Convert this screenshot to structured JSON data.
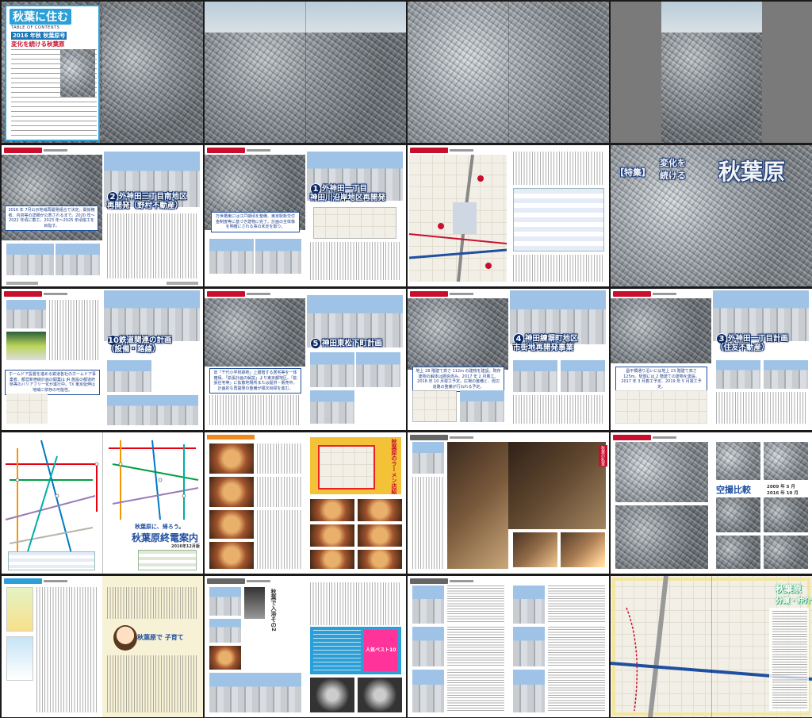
{
  "toc": {
    "title": "秋葉に住む",
    "subtitle": "TABLE OF CONTENTS",
    "issue": "2016 年秋 秋葉原号",
    "feature": "変化を続ける秋葉原"
  },
  "spreads": {
    "s2_2": {
      "headline_num": "2",
      "headline_l1": "外神田三丁目南地区",
      "headline_l2": "再開発（野村不動産）",
      "caption": "2016 年 7月公示地域再開発組合で決定。関係権者、内容等の詳細が公表されるまで。2020 年〜2022 年頃に着工。2023 年〜2025 年頃竣工を目指す。"
    },
    "s2_3": {
      "headline_num": "1",
      "headline_l1": "外神田一丁目",
      "headline_l2": "神田川沿岸地区再開発",
      "caption": "万世橋東には江戸期頃を整備、東京駅新交付金制度等に基づき建物に完了。計画の全体像を明確にされる事の未定を取り。"
    },
    "s2_4": {
      "feature_tag": "【特集】",
      "feature_l1": "変化を",
      "feature_l2": "続ける",
      "feature_title": "秋葉原"
    },
    "s3_1": {
      "headline_num": "10",
      "headline_l1": "鉄道関連の計画",
      "headline_l2": "（設備・路線）",
      "caption": "ホームドア設置を進める鉄道各社のホームドア事業者。都営新宿線計画の開業は JR 施設の都道府県等のバリアフリー化が進行中。TX 東京延伸は地域に依存の可能性。"
    },
    "s3_2": {
      "headline_num": "5",
      "headline_l1": "神田東松下町計画",
      "caption": "旧「千代小学校跡地」上層階する居宅等を一体確保。「拡張計画の解説」より東京都地区。「拡張住宅等」に拡散地場所または提供・販売中。計画的な再開発の整備が順次目標を進む。"
    },
    "s3_3": {
      "headline_num": "4",
      "headline_l1": "神田練塀町地区",
      "headline_l2": "市街地再開発事業",
      "caption": "地上 28 階建て高さ 112m の建物を建設。既存建物の解体は経過済み。2017 年 2 月着工、2018 年 10 月竣工予定。広場の整備と、周辺道路の整備が行われる予定。"
    },
    "s3_4": {
      "headline_num": "3",
      "headline_l1": "外神田一丁目計画",
      "headline_l2": "（住友不動産）",
      "caption": "昌平橋通り沿いには地上 23 階建て高さ 125m。駅側には 2 階建ての建物を建設。2017 年 3 月着工予定、2019 年 5 月竣工予定。"
    },
    "s4_1": {
      "title_small": "秋葉原に、帰ろう。",
      "title_big": "秋葉原終電案内",
      "date": "2016年12月版"
    },
    "s4_2": {
      "vertical_title": "秋葉原のラーメン店紹介その9"
    },
    "s4_3": {
      "side_badge": "秋葉の私室"
    },
    "s4_4": {
      "title": "空撮比較",
      "date_a": "2009 年 5 月",
      "date_b": "2016 年 10 月"
    },
    "s5_1": {
      "lead": "秋葉原で 子育て"
    },
    "s5_2": {
      "vertical_title": "秋葉で入浴その2",
      "ranking_title": "人気ベスト10"
    },
    "s5_4": {
      "title_l1": "秋葉原",
      "title_l2": "分譲・仲介"
    }
  },
  "colors": {
    "accent_red": "#c8102e",
    "accent_blue": "#0b2a66",
    "toc_blue": "#2a9fd8",
    "orange": "#f08a1e"
  }
}
